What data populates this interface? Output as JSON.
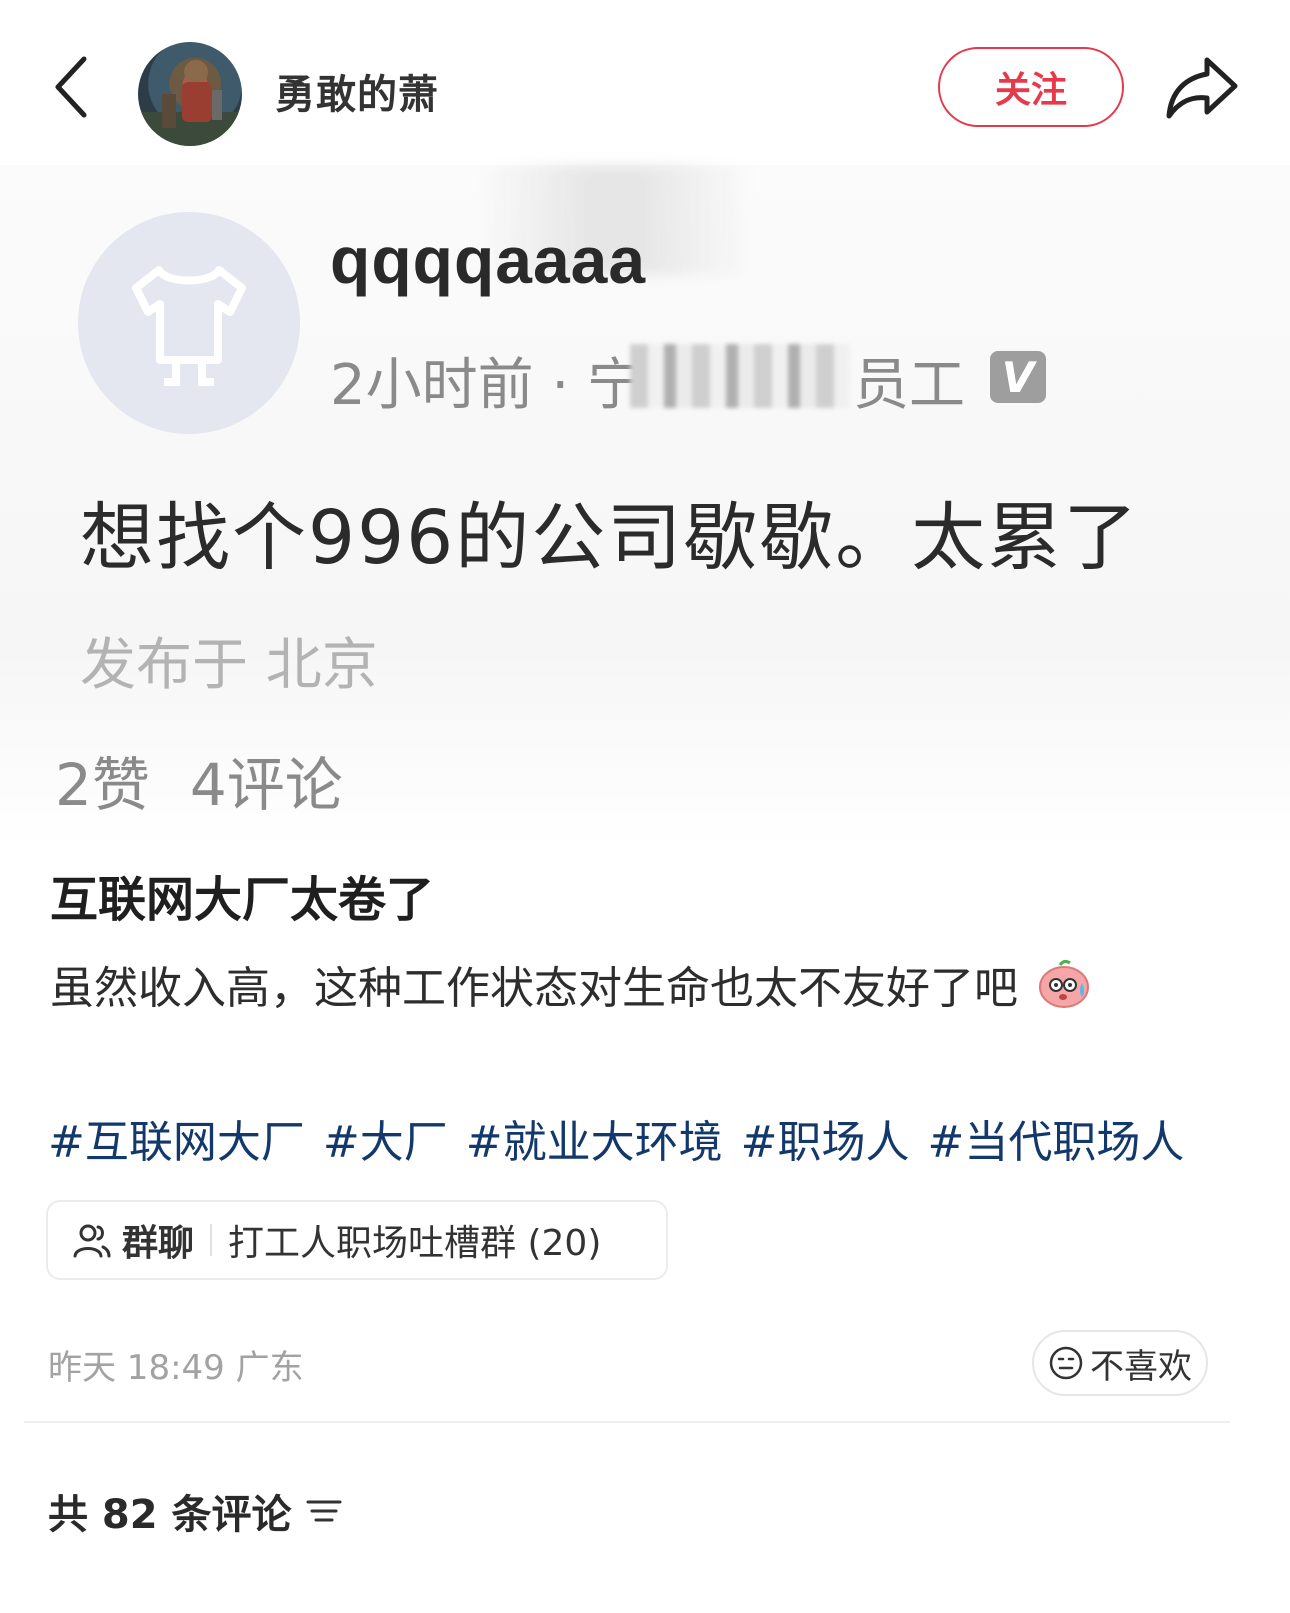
{
  "header": {
    "author_name": "勇敢的萧",
    "follow_label": "关注"
  },
  "quoted_post": {
    "username": "qqqqaaaa",
    "meta_prefix": "2小时前 · 宁",
    "meta_suffix": "员工",
    "verified_badge": "V",
    "text": "想找个996的公司歇歇。太累了",
    "location": "发布于 北京",
    "likes": "2赞",
    "comments": "4评论"
  },
  "note": {
    "title": "互联网大厂太卷了",
    "body": "虽然收入高，这种工作状态对生命也太不友好了吧",
    "tags": [
      "#互联网大厂",
      "#大厂",
      "#就业大环境",
      "#职场人",
      "#当代职场人"
    ]
  },
  "group_chat": {
    "label": "群聊",
    "name": "打工人职场吐槽群 (20)"
  },
  "post_meta": "昨天 18:49 广东",
  "dislike_label": "不喜欢",
  "comments_header": "共 82 条评论",
  "colors": {
    "accent": "#e6394c",
    "tag": "#13386c",
    "muted": "#a2a2a2"
  }
}
